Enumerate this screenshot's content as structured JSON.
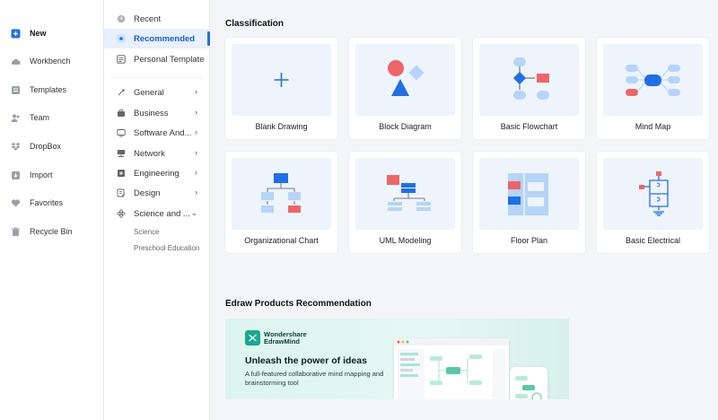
{
  "nav": {
    "items": [
      {
        "label": "New",
        "icon": "plus-square-icon",
        "active": true
      },
      {
        "label": "Workbench",
        "icon": "cloud-icon"
      },
      {
        "label": "Templates",
        "icon": "templates-icon"
      },
      {
        "label": "Team",
        "icon": "team-icon"
      },
      {
        "label": "DropBox",
        "icon": "dropbox-icon"
      },
      {
        "label": "Import",
        "icon": "import-icon"
      },
      {
        "label": "Favorites",
        "icon": "heart-icon"
      },
      {
        "label": "Recycle Bin",
        "icon": "trash-icon"
      }
    ]
  },
  "subnav": {
    "items": [
      {
        "label": "Recent",
        "icon": "clock-icon"
      },
      {
        "label": "Recommended",
        "icon": "star-icon",
        "active": true
      },
      {
        "label": "Personal Template",
        "icon": "template-icon"
      },
      {
        "label": "General",
        "icon": "general-icon",
        "chevron": "›"
      },
      {
        "label": "Business",
        "icon": "business-icon",
        "chevron": "›"
      },
      {
        "label": "Software And...",
        "icon": "software-icon",
        "chevron": "›"
      },
      {
        "label": "Network",
        "icon": "network-icon",
        "chevron": "›"
      },
      {
        "label": "Engineering",
        "icon": "engineering-icon",
        "chevron": "›"
      },
      {
        "label": "Design",
        "icon": "design-icon",
        "chevron": "›"
      },
      {
        "label": "Science and ...",
        "icon": "science-icon",
        "chevron": "⌄"
      }
    ],
    "children": [
      "Science",
      "Preschool Education"
    ]
  },
  "classification": {
    "title": "Classification",
    "cards": [
      {
        "label": "Blank Drawing",
        "icon": "plus-icon"
      },
      {
        "label": "Block Diagram",
        "icon": "block-diagram-icon"
      },
      {
        "label": "Basic Flowchart",
        "icon": "flowchart-icon"
      },
      {
        "label": "Mind Map",
        "icon": "mind-map-icon"
      },
      {
        "label": "Organizational Chart",
        "icon": "org-chart-icon"
      },
      {
        "label": "UML Modeling",
        "icon": "uml-icon"
      },
      {
        "label": "Floor Plan",
        "icon": "floor-plan-icon"
      },
      {
        "label": "Basic Electrical",
        "icon": "electrical-icon"
      }
    ]
  },
  "products": {
    "title": "Edraw Products Recommendation",
    "banner": {
      "brand_line1": "Wondershare",
      "brand_line2": "EdrawMind",
      "headline": "Unleash the power of ideas",
      "description": "A full-featured collaborative mind mapping and brainstorming tool"
    }
  },
  "colors": {
    "accent": "#1f6fe6",
    "thumb_bg": "#eef4fc",
    "shape_blue": "#1f6fe6",
    "shape_red": "#f06468",
    "shape_light": "#b6d4f7",
    "brand_green": "#17a98c"
  }
}
